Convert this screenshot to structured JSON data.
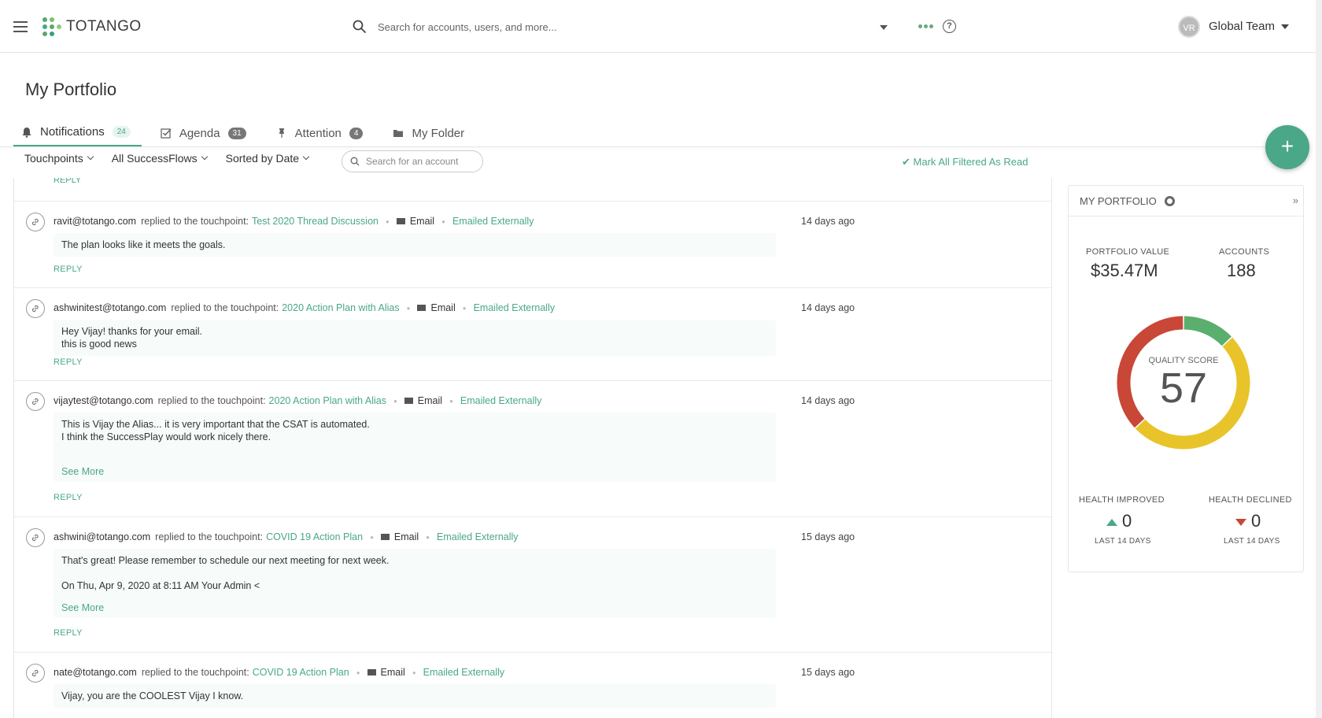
{
  "topbar": {
    "brand": "TOTANGO",
    "search_placeholder": "Search for accounts, users, and more...",
    "avatar_initials": "VR",
    "team": "Global Team"
  },
  "page": {
    "title": "My Portfolio"
  },
  "tabs": [
    {
      "label": "Notifications",
      "count": "24"
    },
    {
      "label": "Agenda",
      "count": "31"
    },
    {
      "label": "Attention",
      "count": "4"
    },
    {
      "label": "My Folder"
    }
  ],
  "filters": {
    "touchpoints": "Touchpoints",
    "successflows": "All SuccessFlows",
    "sort": "Sorted by Date",
    "account_search_placeholder": "Search for an account",
    "mark_read": "Mark All Filtered As Read"
  },
  "fab": {
    "label": "+"
  },
  "feed": {
    "reply_label": "REPLY",
    "mid_text": "replied to the touchpoint:",
    "items": [
      {
        "who": "ravit@totango.com",
        "touchpoint": "Test 2020 Thread Discussion",
        "channel": "Email",
        "status": "Emailed Externally",
        "when": "14 days ago",
        "lines": [
          "The plan looks like it meets the goals."
        ]
      },
      {
        "who": "ashwinitest@totango.com",
        "touchpoint": "2020 Action Plan with Alias",
        "channel": "Email",
        "status": "Emailed Externally",
        "when": "14 days ago",
        "lines": [
          "Hey Vijay! thanks for your email.",
          "this is good news"
        ]
      },
      {
        "who": "vijaytest@totango.com",
        "touchpoint": "2020 Action Plan with Alias",
        "channel": "Email",
        "status": "Emailed Externally",
        "when": "14 days ago",
        "lines": [
          "This is Vijay the Alias... it is very important that the CSAT is automated.",
          "I think the SuccessPlay would work nicely there."
        ],
        "see_more": "See More"
      },
      {
        "who": "ashwini@totango.com",
        "touchpoint": "COVID 19 Action Plan",
        "channel": "Email",
        "status": "Emailed Externally",
        "when": "15 days ago",
        "lines": [
          "That's great! Please remember to schedule our next meeting for next week.",
          "On Thu, Apr 9, 2020 at 8:11 AM Your Admin <"
        ],
        "see_more": "See More"
      },
      {
        "who": "nate@totango.com",
        "touchpoint": "COVID 19 Action Plan",
        "channel": "Email",
        "status": "Emailed Externally",
        "when": "15 days ago",
        "lines": [
          "Vijay, you are the COOLEST Vijay I know."
        ]
      }
    ]
  },
  "portfolio": {
    "title": "MY PORTFOLIO",
    "value_label": "PORTFOLIO VALUE",
    "value": "$35.47M",
    "accounts_label": "ACCOUNTS",
    "accounts": "188",
    "quality_label": "QUALITY SCORE",
    "quality_score": "57",
    "gauge_segments": [
      {
        "color": "#5aae6e",
        "fraction": 0.13
      },
      {
        "color": "#e8c42a",
        "fraction": 0.5
      },
      {
        "color": "#c94737",
        "fraction": 0.37
      }
    ],
    "improved_label": "HEALTH IMPROVED",
    "improved": "0",
    "declined_label": "HEALTH DECLINED",
    "declined": "0",
    "period": "LAST 14 DAYS"
  }
}
